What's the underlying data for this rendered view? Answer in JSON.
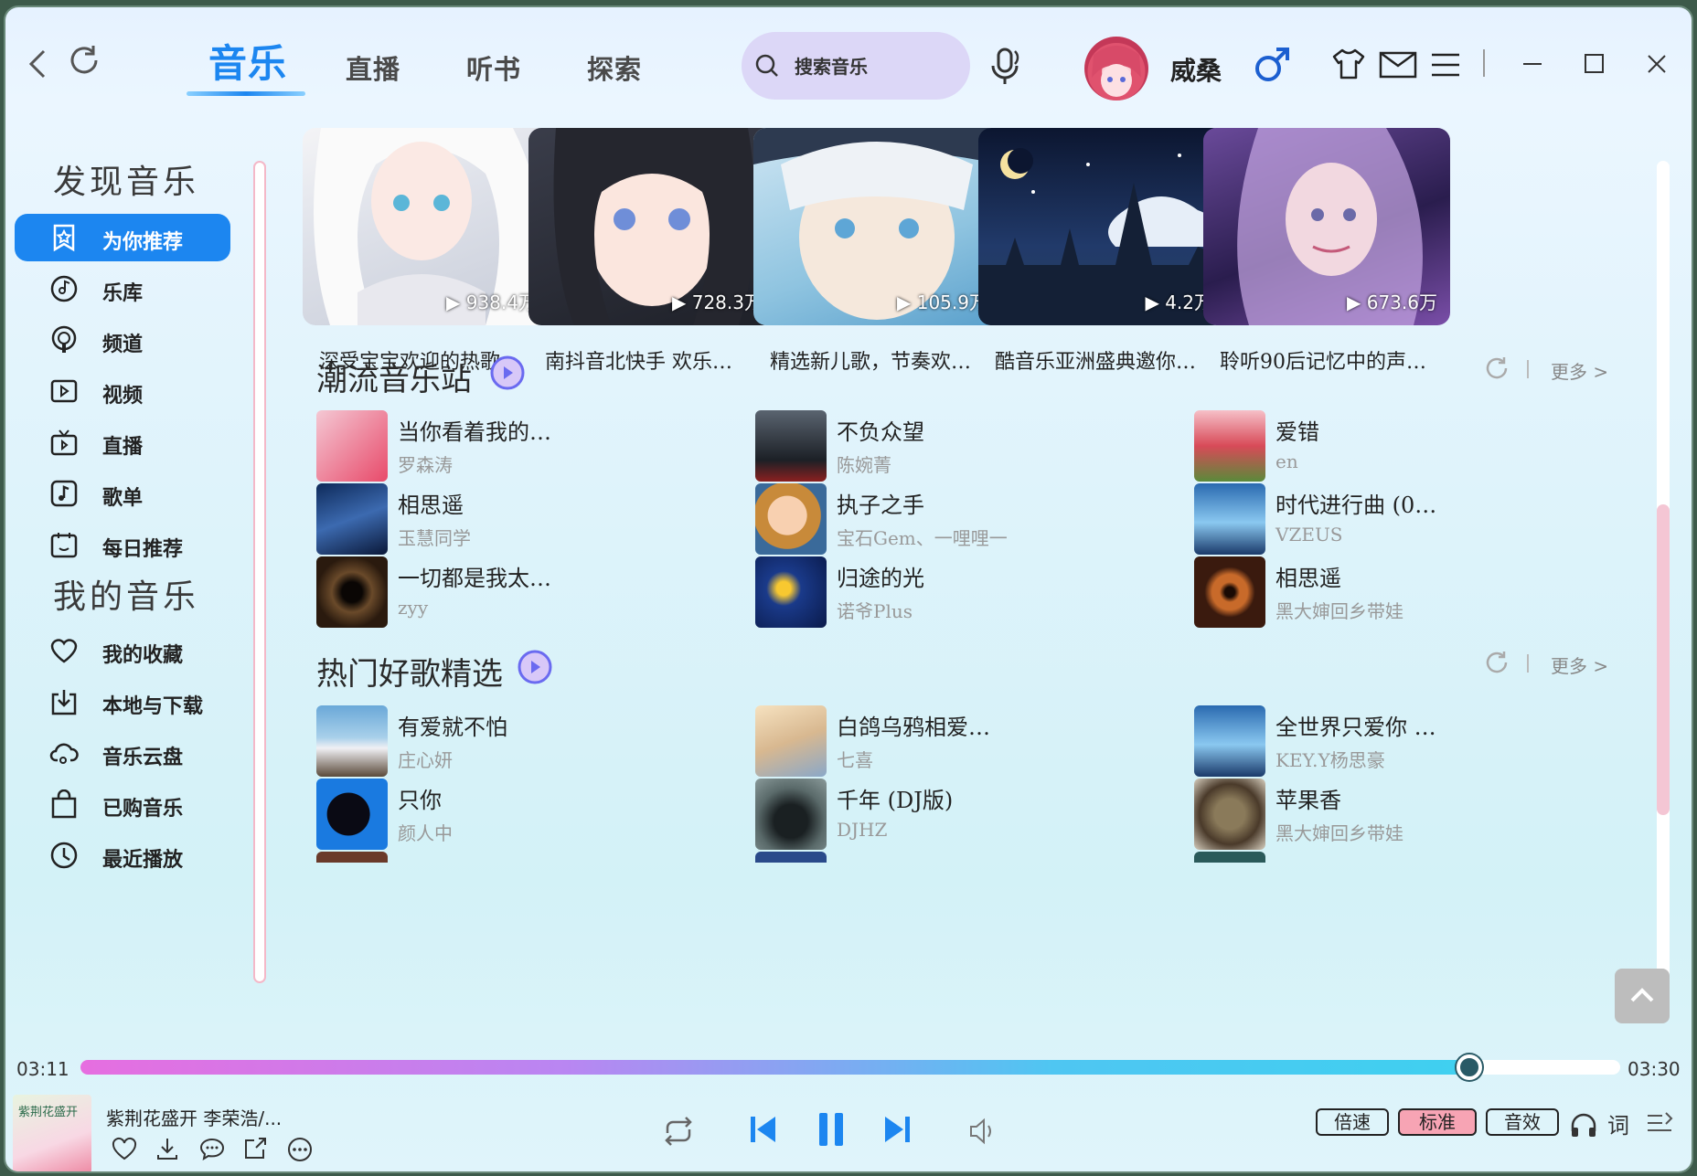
{
  "nav": {
    "tabs": [
      "音乐",
      "直播",
      "听书",
      "探索"
    ],
    "active_tab": "音乐"
  },
  "search": {
    "placeholder": "搜索音乐"
  },
  "user": {
    "name": "威桑"
  },
  "sidebar": {
    "discover_title": "发现音乐",
    "discover_items": [
      {
        "label": "为你推荐",
        "icon": "star-icon"
      },
      {
        "label": "乐库",
        "icon": "music-disc-icon"
      },
      {
        "label": "频道",
        "icon": "podcast-icon"
      },
      {
        "label": "视频",
        "icon": "video-icon"
      },
      {
        "label": "直播",
        "icon": "tv-icon"
      },
      {
        "label": "歌单",
        "icon": "playlist-icon"
      },
      {
        "label": "每日推荐",
        "icon": "calendar-icon"
      }
    ],
    "my_title": "我的音乐",
    "my_items": [
      {
        "label": "我的收藏",
        "icon": "heart-icon"
      },
      {
        "label": "本地与下载",
        "icon": "download-icon"
      },
      {
        "label": "音乐云盘",
        "icon": "cloud-icon"
      },
      {
        "label": "已购音乐",
        "icon": "bag-icon"
      },
      {
        "label": "最近播放",
        "icon": "clock-icon"
      }
    ]
  },
  "playlists": [
    {
      "plays": "938.4万",
      "title": "深受宝宝欢迎的热歌"
    },
    {
      "plays": "728.3万",
      "title": "南抖音北快手 欢乐…"
    },
    {
      "plays": "105.9万",
      "title": "精选新儿歌，节奏欢…"
    },
    {
      "plays": "4.2万",
      "title": "酷音乐亚洲盛典邀你…"
    },
    {
      "plays": "673.6万",
      "title": "聆听90后记忆中的声…"
    }
  ],
  "sections": [
    {
      "title": "潮流音乐站",
      "more": "更多 >",
      "songs": [
        {
          "name": "当你看着我的…",
          "artist": "罗森涛"
        },
        {
          "name": "不负众望",
          "artist": "陈婉菁"
        },
        {
          "name": "爱错",
          "artist": "en"
        },
        {
          "name": "相思遥",
          "artist": "玉慧同学"
        },
        {
          "name": "执子之手",
          "artist": "宝石Gem、一哩哩一"
        },
        {
          "name": "时代进行曲 (0…",
          "artist": "VZEUS"
        },
        {
          "name": "一切都是我太…",
          "artist": "zyy"
        },
        {
          "name": "归途的光",
          "artist": "诺爷Plus"
        },
        {
          "name": "相思遥",
          "artist": "黑大婶回乡带娃"
        }
      ]
    },
    {
      "title": "热门好歌精选",
      "more": "更多 >",
      "songs": [
        {
          "name": "有爱就不怕",
          "artist": "庄心妍"
        },
        {
          "name": "白鸽乌鸦相爱…",
          "artist": "七喜"
        },
        {
          "name": "全世界只爱你 …",
          "artist": "KEY.Y杨思豪"
        },
        {
          "name": "只你",
          "artist": "颜人中"
        },
        {
          "name": "千年 (DJ版)",
          "artist": "DJHZ"
        },
        {
          "name": "苹果香",
          "artist": "黑大婶回乡带娃"
        }
      ]
    }
  ],
  "player": {
    "time_current": "03:11",
    "time_total": "03:30",
    "progress": 0.902,
    "now_playing": "紫荆花盛开  李荣浩/...",
    "cover_text": "紫荆花盛开",
    "speed_label": "倍速",
    "quality_label": "标准",
    "effect_label": "音效",
    "lyrics_label": "词"
  }
}
